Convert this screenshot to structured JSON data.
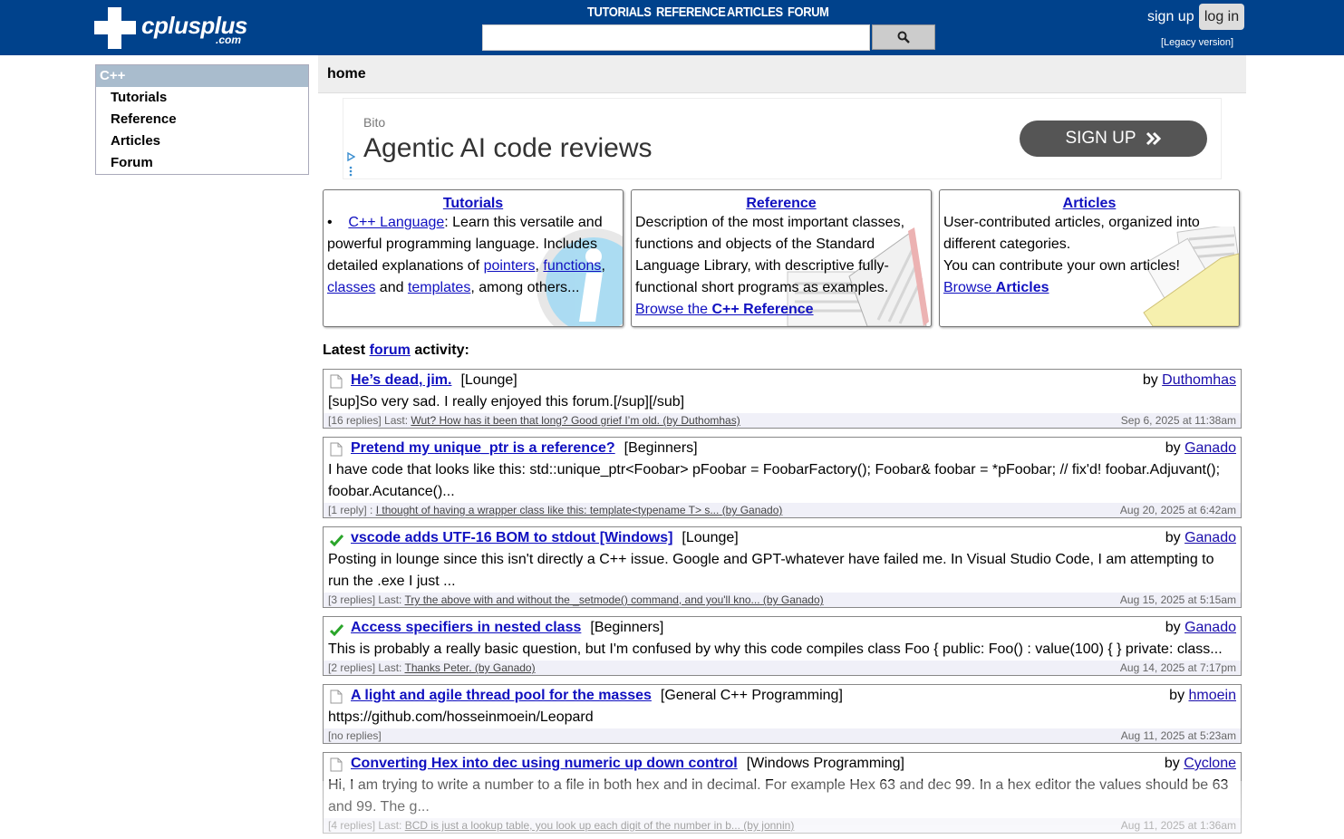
{
  "header": {
    "logo_text": "cplusplus",
    "logo_domain": ".com",
    "nav": [
      "TUTORIALS",
      "REFERENCE",
      "ARTICLES",
      "FORUM"
    ],
    "search_value": "",
    "search_icon": "magnifier-icon",
    "signup_label": "sign up",
    "login_label": "log in",
    "legacy_label": "[Legacy version]"
  },
  "sidebar": {
    "heading": "C++",
    "items": [
      "Tutorials",
      "Reference",
      "Articles",
      "Forum"
    ]
  },
  "page": {
    "title": "home"
  },
  "ad": {
    "advertiser": "Bito",
    "headline": "Agentic AI code reviews",
    "button": "SIGN UP",
    "button_icon": "double-chevron-right-icon"
  },
  "boxes": {
    "tutorials": {
      "title": "Tutorials",
      "bullet": "•",
      "link_lang": "C++ Language",
      "text1": ": Learn this versatile and powerful programming language. Includes detailed explanations of ",
      "link_pointers": "pointers",
      "sep1": ", ",
      "link_functions": "functions",
      "sep2": ", ",
      "link_classes": "classes",
      "sep3": " and ",
      "link_templates": "templates",
      "text2": ", among others..."
    },
    "reference": {
      "title": "Reference",
      "text": "Description of the most important classes, functions and objects of the Standard Language Library, with descriptive fully-functional short programs as examples.",
      "link_pre": "Browse the ",
      "link_strong": "C++ Reference"
    },
    "articles": {
      "title": "Articles",
      "text1": "User-contributed articles, organized into different categories.",
      "text2": "You can contribute your own articles!",
      "link_pre": "Browse ",
      "link_strong": "Articles"
    }
  },
  "latest": {
    "pre": "Latest ",
    "link": "forum",
    "post": " activity:"
  },
  "posts": [
    {
      "title": "He’s dead, jim.",
      "category": "[Lounge]",
      "by": "by ",
      "author": "Duthomhas",
      "desc": "[sup]So very sad. I really enjoyed this forum.[/sup][/sub]",
      "meta_pre": "[16 replies] Last: ",
      "last_link": "Wut? How has it been that long? Good grief I’m old.",
      "last_by": "(by Duthomhas)",
      "date": "Sep 6, 2025 at 11:38am",
      "icon": "document-icon"
    },
    {
      "title": "Pretend my unique_ptr is a reference?",
      "category": "[Beginners]",
      "by": "by ",
      "author": "Ganado",
      "desc": "I have code that looks like this: std::unique_ptr<Foobar> pFoobar = FoobarFactory(); Foobar& foobar = *pFoobar; // fix'd! foobar.Adjuvant(); foobar.Acutance()...",
      "meta_pre": "[1 reply] : ",
      "last_link": "I thought of having a wrapper class like this: template<typename T> s...",
      "last_by": "(by Ganado)",
      "date": "Aug 20, 2025 at 6:42am",
      "icon": "document-icon"
    },
    {
      "title": "vscode adds UTF-16 BOM to stdout [Windows]",
      "category": "[Lounge]",
      "by": "by ",
      "author": "Ganado",
      "desc": "Posting in lounge since this isn't directly a C++ issue. Google and GPT-whatever have failed me. In Visual Studio Code, I am attempting to run the .exe I just ...",
      "meta_pre": "[3 replies] Last: ",
      "last_link": "Try the above with and without the _setmode() command, and you'll kno...",
      "last_by": "(by Ganado)",
      "date": "Aug 15, 2025 at 5:15am",
      "icon": "checkmark-icon"
    },
    {
      "title": "Access specifiers in nested class",
      "category": "[Beginners]",
      "by": "by ",
      "author": "Ganado",
      "desc": "This is probably a really basic question, but I'm confused by why this code compiles class Foo { public: Foo() : value(100) { } private: class...",
      "meta_pre": "[2 replies] Last: ",
      "last_link": "Thanks Peter.",
      "last_by": "(by Ganado)",
      "date": "Aug 14, 2025 at 7:17pm",
      "icon": "checkmark-icon"
    },
    {
      "title": "A light and agile thread pool for the masses",
      "category": "[General C++ Programming]",
      "by": "by ",
      "author": "hmoein",
      "desc": "https://github.com/hosseinmoein/Leopard",
      "meta_pre": "[no replies]",
      "last_link": "",
      "last_by": "",
      "date": "Aug 11, 2025 at 5:23am",
      "icon": "document-icon"
    },
    {
      "title": "Converting Hex into dec using numeric up down control",
      "category": "[Windows Programming]",
      "by": "by ",
      "author": "Cyclone",
      "desc": "Hi, I am trying to write a number to a file in both hex and in decimal. For example Hex 63 and dec 99. In a hex editor the values should be 63 and 99. The g...",
      "meta_pre": "[4 replies] Last: ",
      "last_link": "BCD is just a lookup table, you look up each digit of the number in b...",
      "last_by": "(by jonnin)",
      "date": "Aug 11, 2025 at 1:36am",
      "icon": "document-icon"
    }
  ],
  "colors": {
    "header_bg": "#00428c",
    "sidebar_head": "#a9bccd",
    "link": "#1010c0",
    "check": "#2aa52a"
  }
}
